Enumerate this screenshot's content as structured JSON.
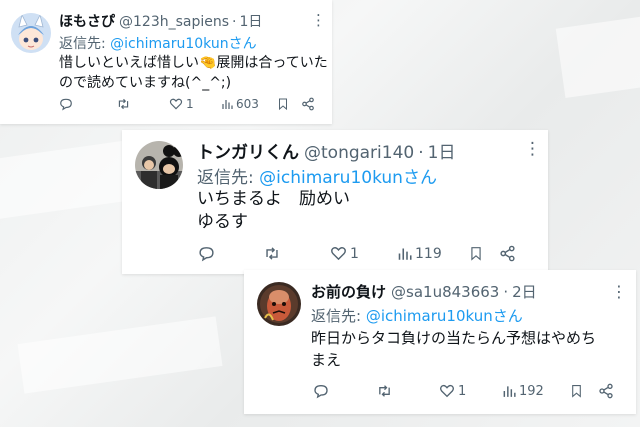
{
  "tweets": [
    {
      "name": "ほもさぴ",
      "handle": "@123h_sapiens",
      "separator": "·",
      "time": "1日",
      "reply_prefix": "返信先:",
      "reply_to": "@ichimaru10kunさん",
      "lines": [
        "惜しいといえば惜しい🤏展開は合っていた",
        "ので読めていますね(^_^;)"
      ],
      "counts": {
        "replies": "",
        "retweets": "",
        "likes": "1",
        "views": "603"
      },
      "icons": [
        "reply-icon",
        "retweet-icon",
        "like-icon",
        "views-icon",
        "bookmark-icon",
        "share-icon"
      ]
    },
    {
      "name": "トンガリくん",
      "handle": "@tongari140",
      "separator": "·",
      "time": "1日",
      "reply_prefix": "返信先:",
      "reply_to": "@ichimaru10kunさん",
      "lines": [
        "いちまるよ　励めい",
        "ゆるす"
      ],
      "counts": {
        "replies": "",
        "retweets": "",
        "likes": "1",
        "views": "119"
      },
      "icons": [
        "reply-icon",
        "retweet-icon",
        "like-icon",
        "views-icon",
        "bookmark-icon",
        "share-icon"
      ]
    },
    {
      "name": "お前の負け",
      "handle": "@sa1u843663",
      "separator": "·",
      "time": "2日",
      "reply_prefix": "返信先:",
      "reply_to": "@ichimaru10kunさん",
      "lines": [
        "昨日からタコ負けの当たらん予想はやめち",
        "まえ"
      ],
      "counts": {
        "replies": "",
        "retweets": "",
        "likes": "1",
        "views": "192"
      },
      "icons": [
        "reply-icon",
        "retweet-icon",
        "like-icon",
        "views-icon",
        "bookmark-icon",
        "share-icon"
      ]
    }
  ],
  "more_glyph": "⋮",
  "colors": {
    "link": "#1d9bf0",
    "meta": "#536471",
    "text": "#0f1419",
    "background": "#eceeee"
  }
}
